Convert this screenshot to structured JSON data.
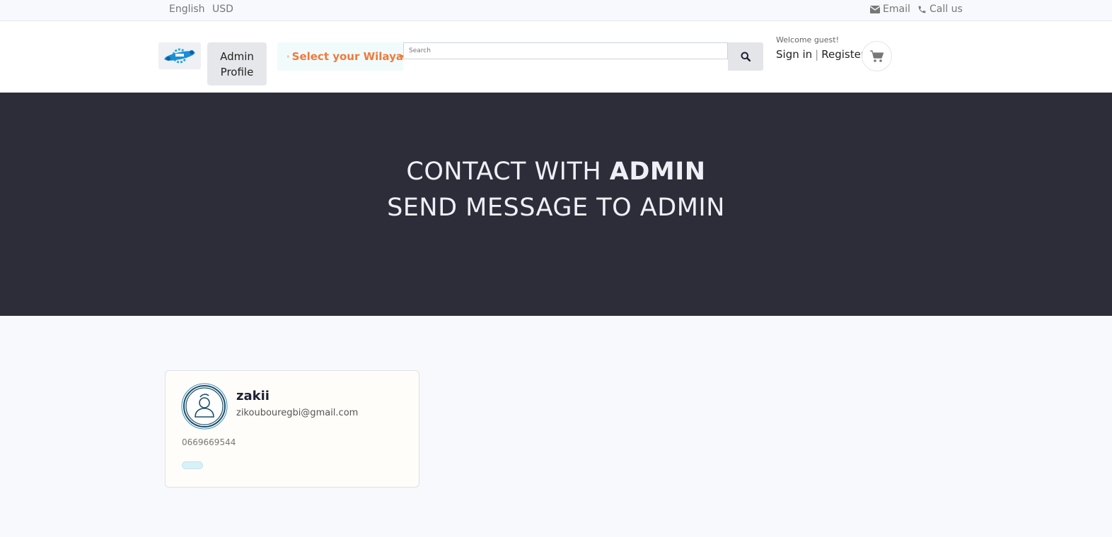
{
  "topbar": {
    "language": "English",
    "currency": "USD",
    "email_label": "Email",
    "call_label": "Call us"
  },
  "header": {
    "admin_profile_label": "Admin Profile",
    "wilaya_label": "Select your Wilaya",
    "search_placeholder": "Search",
    "welcome_text": "Welcome guest!",
    "signin_label": "Sign in",
    "separator": "|",
    "register_label": "Register"
  },
  "hero": {
    "line1_prefix": "CONTACT WITH ",
    "line1_bold": "ADMIN",
    "line2": "SEND MESSAGE TO ADMIN"
  },
  "admin_card": {
    "name": "zakii",
    "email": "zikoubouregbi@gmail.com",
    "phone": "0669669544"
  },
  "colors": {
    "accent": "#f07a3c",
    "hero_bg": "#2d2d3a",
    "page_bg": "#f7f9fc"
  },
  "icons": [
    "envelope-icon",
    "phone-icon",
    "bars-icon",
    "caret-down-icon",
    "search-icon",
    "cart-icon",
    "user-avatar-icon",
    "logo-icon"
  ]
}
